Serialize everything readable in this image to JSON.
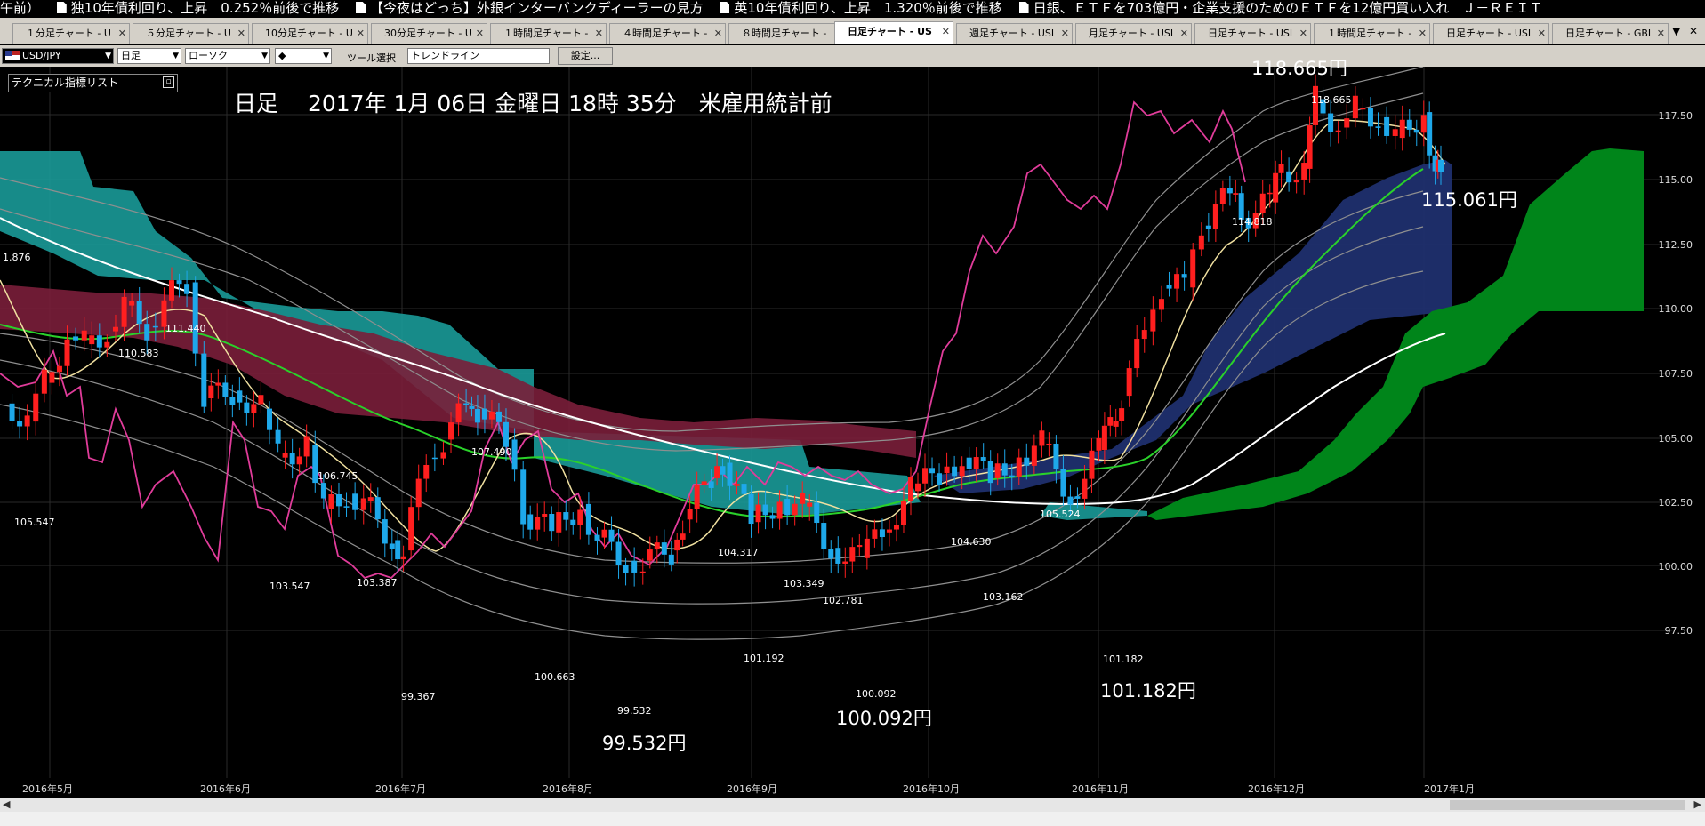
{
  "ticker": [
    "午前）",
    "独10年債利回り、上昇　0.252％前後で推移",
    "【今夜はどっち】外銀インターバンクディーラーの見方",
    "英10年債利回り、上昇　1.320％前後で推移",
    "日銀、ＥＴＦを703億円・企業支援のためのＥＴＦを12億円買い入れ　Ｊ－ＲＥＩＴ"
  ],
  "tabs": [
    {
      "label": "１分足チャート - U",
      "active": false
    },
    {
      "label": "５分足チャート - U",
      "active": false
    },
    {
      "label": "10分足チャート - U",
      "active": false
    },
    {
      "label": "30分足チャート - U",
      "active": false
    },
    {
      "label": "１時間足チャート -",
      "active": false
    },
    {
      "label": "４時間足チャート -",
      "active": false
    },
    {
      "label": "８時間足チャート -",
      "active": false
    },
    {
      "label": "日足チャート - US",
      "active": true
    },
    {
      "label": "週足チャート - USI",
      "active": false
    },
    {
      "label": "月足チャート - USI",
      "active": false
    },
    {
      "label": "日足チャート - USI",
      "active": false
    },
    {
      "label": "１時間足チャート -",
      "active": false
    },
    {
      "label": "日足チャート - USI",
      "active": false
    },
    {
      "label": "日足チャート - GBI",
      "active": false
    }
  ],
  "toolbar": {
    "symbol": "USD/JPY",
    "timeframe": "日足",
    "chart_type": "ローソク",
    "bullet": "◆",
    "tool_label": "ツール選択",
    "tool_value": "トレンドライン",
    "settings_button": "設定..."
  },
  "indicator_panel": {
    "label": "テクニカル指標リスト"
  },
  "chart_title": "日足　 2017年 1月 06日 金曜日 18時 35分　米雇用統計前",
  "callouts": {
    "high": "118.665円",
    "last": "115.061円",
    "low1": "99.532円",
    "low2": "100.092円",
    "low3": "101.182円"
  },
  "price_labels": [
    {
      "text": "1.876"
    },
    {
      "text": "105.547"
    },
    {
      "text": "110.583"
    },
    {
      "text": "111.440"
    },
    {
      "text": "106.745"
    },
    {
      "text": "103.547"
    },
    {
      "text": "103.387"
    },
    {
      "text": "99.367"
    },
    {
      "text": "107.490"
    },
    {
      "text": "100.663"
    },
    {
      "text": "99.532"
    },
    {
      "text": "104.317"
    },
    {
      "text": "103.349"
    },
    {
      "text": "101.192"
    },
    {
      "text": "102.781"
    },
    {
      "text": "100.092"
    },
    {
      "text": "104.630"
    },
    {
      "text": "103.162"
    },
    {
      "text": "105.524"
    },
    {
      "text": "101.182"
    },
    {
      "text": "114.818"
    },
    {
      "text": "118.665"
    }
  ],
  "chart_data": {
    "type": "candlestick",
    "symbol": "USD/JPY",
    "timeframe": "daily",
    "y_axis": {
      "ticks": [
        "117.50",
        "115.00",
        "112.50",
        "110.00",
        "107.50",
        "105.00",
        "102.50",
        "100.00",
        "97.50"
      ],
      "range": [
        97.5,
        119.0
      ]
    },
    "x_axis": {
      "ticks": [
        "2016年5月",
        "2016年6月",
        "2016年7月",
        "2016年8月",
        "2016年9月",
        "2016年10月",
        "2016年11月",
        "2016年12月",
        "2017年1月"
      ]
    },
    "key_points": [
      {
        "date": "2016-06-24",
        "value": 99.367
      },
      {
        "date": "2016-08-16",
        "value": 99.532
      },
      {
        "date": "2016-09-30",
        "value": 100.092
      },
      {
        "date": "2016-11-09",
        "value": 101.182
      },
      {
        "date": "2016-12-15",
        "value": 118.665
      },
      {
        "date": "2017-01-06",
        "value": 115.061
      }
    ],
    "close_path": [
      [
        "2016-04-29",
        106.3
      ],
      [
        "2016-05-03",
        105.6
      ],
      [
        "2016-05-06",
        107.1
      ],
      [
        "2016-05-10",
        108.9
      ],
      [
        "2016-05-13",
        108.6
      ],
      [
        "2016-05-17",
        109.1
      ],
      [
        "2016-05-20",
        110.1
      ],
      [
        "2016-05-24",
        109.3
      ],
      [
        "2016-05-27",
        110.3
      ],
      [
        "2016-05-31",
        111.0
      ],
      [
        "2016-06-03",
        106.5
      ],
      [
        "2016-06-08",
        106.8
      ],
      [
        "2016-06-13",
        106.1
      ],
      [
        "2016-06-16",
        104.2
      ],
      [
        "2016-06-21",
        104.7
      ],
      [
        "2016-06-24",
        102.2
      ],
      [
        "2016-06-28",
        102.8
      ],
      [
        "2016-07-01",
        102.5
      ],
      [
        "2016-07-06",
        101.0
      ],
      [
        "2016-07-08",
        100.6
      ],
      [
        "2016-07-12",
        104.2
      ],
      [
        "2016-07-15",
        104.9
      ],
      [
        "2016-07-19",
        106.2
      ],
      [
        "2016-07-21",
        106.1
      ],
      [
        "2016-07-26",
        104.9
      ],
      [
        "2016-07-29",
        102.0
      ],
      [
        "2016-08-03",
        101.3
      ],
      [
        "2016-08-08",
        102.4
      ],
      [
        "2016-08-11",
        101.1
      ],
      [
        "2016-08-16",
        100.2
      ],
      [
        "2016-08-19",
        100.2
      ],
      [
        "2016-08-24",
        100.6
      ],
      [
        "2016-08-26",
        101.8
      ],
      [
        "2016-08-31",
        103.4
      ],
      [
        "2016-09-02",
        104.0
      ],
      [
        "2016-09-07",
        101.7
      ],
      [
        "2016-09-12",
        102.6
      ],
      [
        "2016-09-16",
        102.3
      ],
      [
        "2016-09-21",
        100.7
      ],
      [
        "2016-09-26",
        100.3
      ],
      [
        "2016-09-30",
        101.3
      ],
      [
        "2016-10-05",
        102.9
      ],
      [
        "2016-10-10",
        103.6
      ],
      [
        "2016-10-14",
        104.2
      ],
      [
        "2016-10-19",
        103.4
      ],
      [
        "2016-10-24",
        104.2
      ],
      [
        "2016-10-28",
        104.7
      ],
      [
        "2016-11-02",
        102.7
      ],
      [
        "2016-11-07",
        104.5
      ],
      [
        "2016-11-09",
        105.4
      ],
      [
        "2016-11-11",
        106.6
      ],
      [
        "2016-11-15",
        109.1
      ],
      [
        "2016-11-18",
        110.9
      ],
      [
        "2016-11-22",
        110.8
      ],
      [
        "2016-11-25",
        113.2
      ],
      [
        "2016-11-30",
        114.4
      ],
      [
        "2016-12-02",
        113.5
      ],
      [
        "2016-12-07",
        114.1
      ],
      [
        "2016-12-09",
        115.3
      ],
      [
        "2016-12-13",
        115.4
      ],
      [
        "2016-12-15",
        118.1
      ],
      [
        "2016-12-19",
        117.0
      ],
      [
        "2016-12-22",
        117.7
      ],
      [
        "2016-12-26",
        117.4
      ],
      [
        "2016-12-29",
        116.6
      ],
      [
        "2017-01-03",
        117.6
      ],
      [
        "2017-01-05",
        115.3
      ],
      [
        "2017-01-06",
        115.1
      ]
    ],
    "colors": {
      "up_candle": "#ff1f1f",
      "down_candle": "#1ea8ea",
      "cloud_upper": "#1a9a98",
      "cloud_lower": "#7a1e3a",
      "cloud_future": "#00851a",
      "rsi_line": "#e03c9a",
      "short_ma": "#f0e0a0",
      "mid_ma": "#2ad12a",
      "long_ma": "#ffffff",
      "envelope": "#9a9a9a"
    }
  },
  "colors": {
    "background": "#000000",
    "tabbar": "#d4d0c8"
  }
}
